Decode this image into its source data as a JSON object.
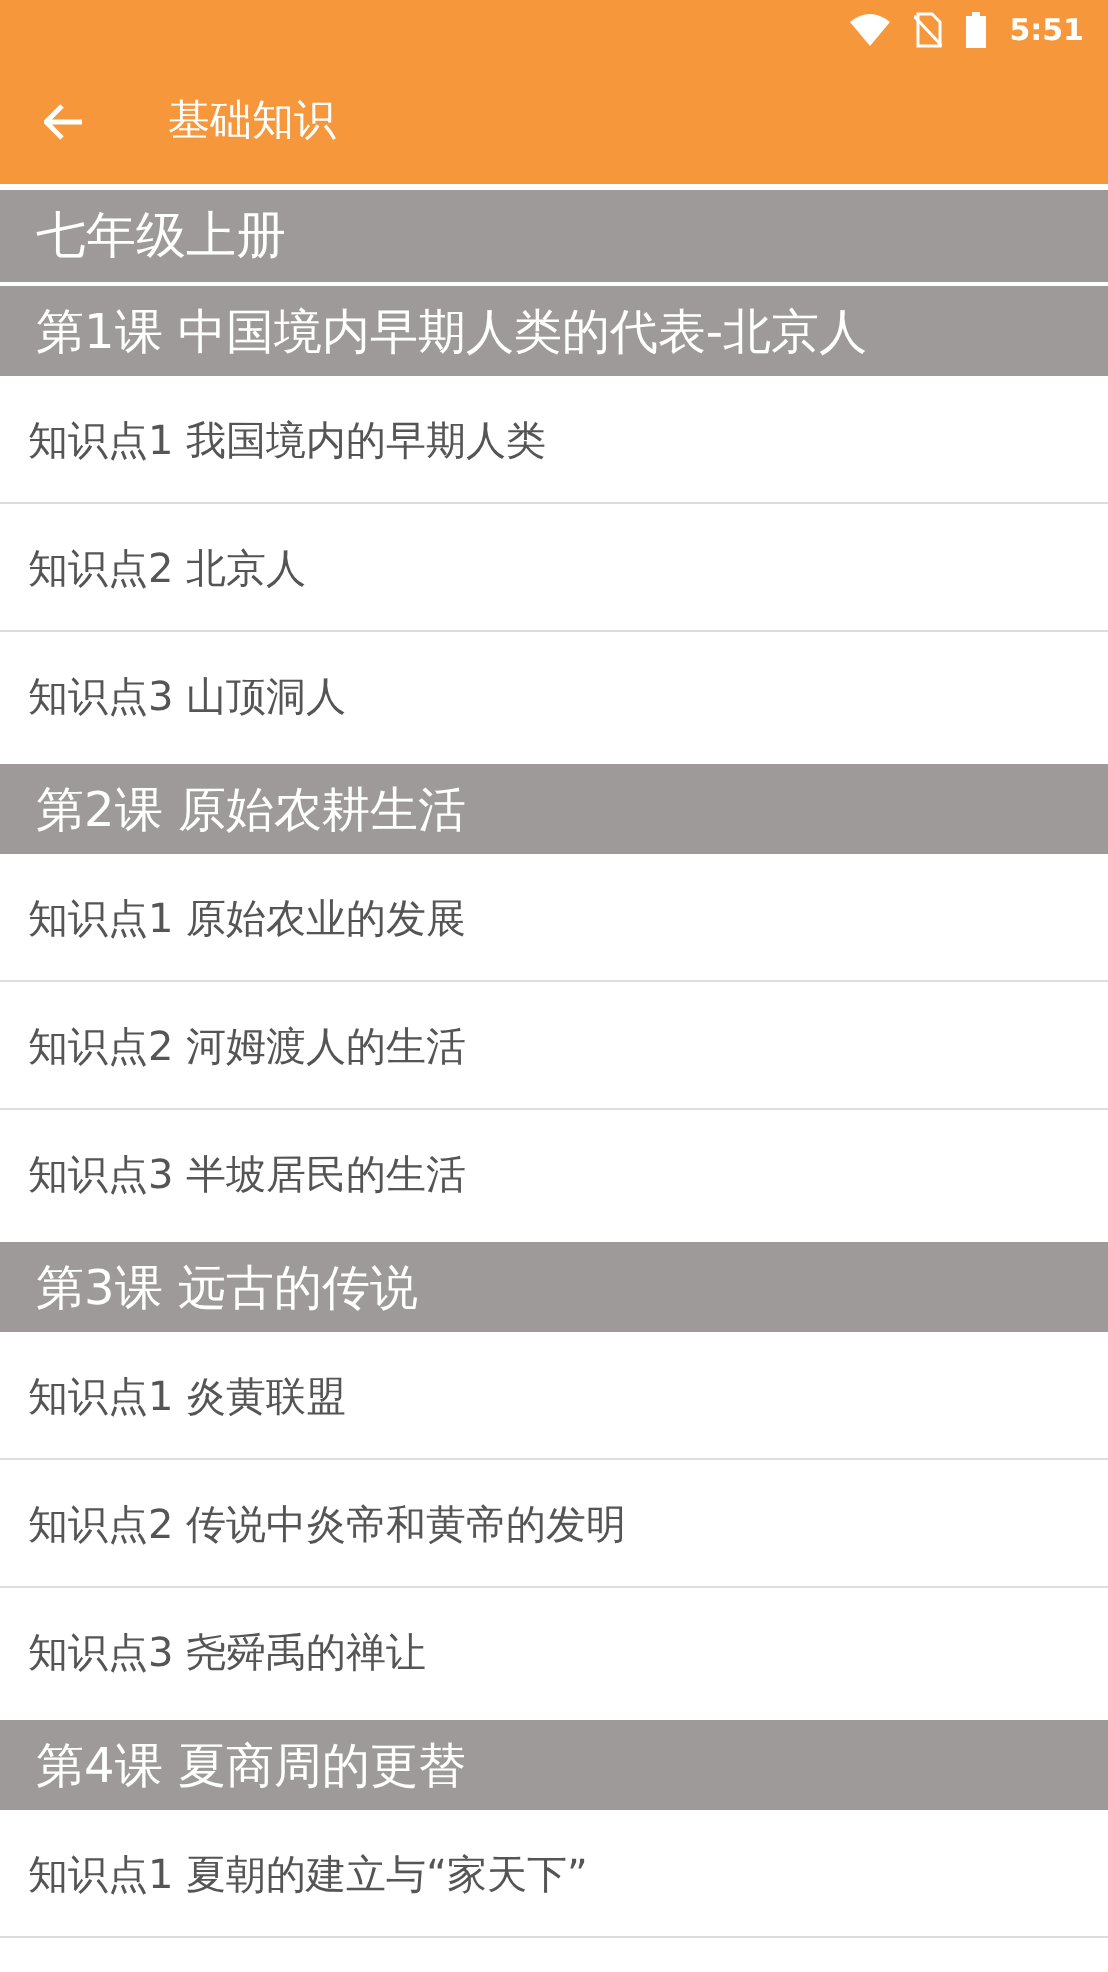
{
  "status_bar": {
    "time": "5:51"
  },
  "app_bar": {
    "title": "基础知识"
  },
  "grades": [
    {
      "title": "七年级上册",
      "lessons": [
        {
          "title": "第1课 中国境内早期人类的代表-北京人",
          "items": [
            "知识点1 我国境内的早期人类",
            "知识点2 北京人",
            "知识点3 山顶洞人"
          ]
        },
        {
          "title": "第2课 原始农耕生活",
          "items": [
            "知识点1 原始农业的发展",
            "知识点2 河姆渡人的生活",
            "知识点3 半坡居民的生活"
          ]
        },
        {
          "title": "第3课 远古的传说",
          "items": [
            "知识点1 炎黄联盟",
            "知识点2 传说中炎帝和黄帝的发明",
            "知识点3 尧舜禹的禅让"
          ]
        },
        {
          "title": "第4课 夏商周的更替",
          "items": [
            "知识点1 夏朝的建立与“家天下”"
          ]
        }
      ]
    }
  ]
}
